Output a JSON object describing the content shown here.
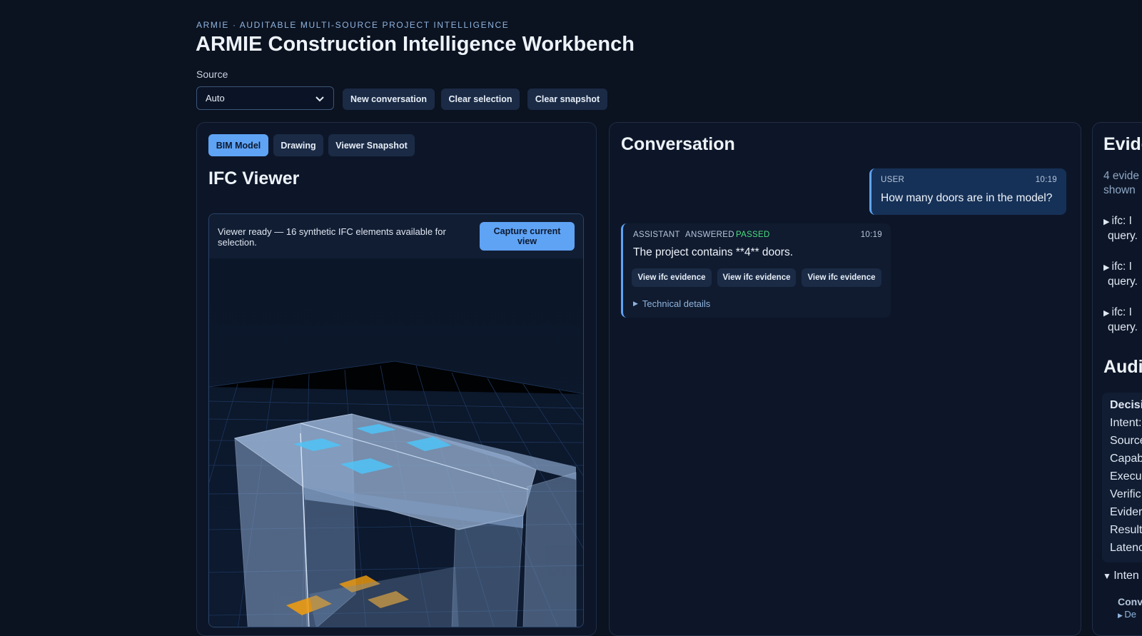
{
  "header": {
    "eyebrow": "ARMIE · AUDITABLE MULTI-SOURCE PROJECT INTELLIGENCE",
    "title": "ARMIE Construction Intelligence Workbench"
  },
  "controls": {
    "source_label": "Source",
    "source_value": "Auto",
    "new_conversation": "New conversation",
    "clear_selection": "Clear selection",
    "clear_snapshot": "Clear snapshot"
  },
  "left_panel": {
    "tabs": [
      {
        "label": "BIM Model",
        "active": true
      },
      {
        "label": "Drawing",
        "active": false
      },
      {
        "label": "Viewer Snapshot",
        "active": false
      }
    ],
    "heading": "IFC Viewer",
    "viewer_status": "Viewer ready — 16 synthetic IFC elements available for selection.",
    "capture_button": "Capture current view"
  },
  "conversation": {
    "heading": "Conversation",
    "user_message": {
      "role": "USER",
      "time": "10:19",
      "text": "How many doors are in the model?"
    },
    "assistant_message": {
      "role": "ASSISTANT",
      "state": "ANSWERED",
      "verification": "PASSED",
      "time": "10:19",
      "text": "The project contains **4** doors.",
      "evidence_buttons": [
        "View ifc evidence",
        "View ifc evidence",
        "View ifc evidence"
      ],
      "details_label": "Technical details"
    }
  },
  "evidence_panel": {
    "heading": "Evide",
    "summary_line1": "4 evide",
    "summary_line2": "shown",
    "items": [
      {
        "line1": "ifc: I",
        "line2": "query."
      },
      {
        "line1": "ifc: I",
        "line2": "query."
      },
      {
        "line1": "ifc: I",
        "line2": "query."
      }
    ],
    "audit_heading": "Audit",
    "audit_lines": [
      "Decisi",
      "Intent:",
      "Source",
      "Capab",
      "Execu",
      "Verific",
      "Evider",
      "Result",
      "Latenc"
    ],
    "intent_toggle": "Inten",
    "conv_label": "Conv",
    "sub_toggle": "De"
  },
  "colors": {
    "background": "#0b1220",
    "panel": "#0d1628",
    "accent": "#5fa3f5",
    "passed": "#4ade80",
    "button": "#1b2b46"
  }
}
